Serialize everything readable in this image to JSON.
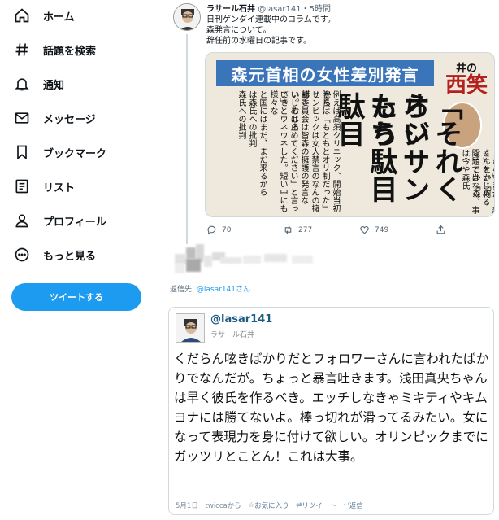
{
  "sidebar": {
    "items": [
      {
        "label": "ホーム",
        "icon": "home-icon"
      },
      {
        "label": "話題を検索",
        "icon": "hashtag-icon"
      },
      {
        "label": "通知",
        "icon": "bell-icon"
      },
      {
        "label": "メッセージ",
        "icon": "mail-icon"
      },
      {
        "label": "ブックマーク",
        "icon": "bookmark-icon"
      },
      {
        "label": "リスト",
        "icon": "list-icon"
      },
      {
        "label": "プロフィール",
        "icon": "person-icon"
      },
      {
        "label": "もっと見る",
        "icon": "more-icon"
      }
    ],
    "tweet_button": "ツイートする"
  },
  "tweet": {
    "name": "ラサール石井",
    "handle": "@lasar141",
    "separator": "・",
    "time": "5時間",
    "lines": [
      "日刊ゲンダイ連載中のコラムです。",
      "森発言について。",
      "辞任前の水曜日の記事です。"
    ],
    "media": {
      "banner": "森元首相の女性差別発言",
      "column_small": "井の",
      "column_big": "西笑",
      "headline_columns": [
        "「それくらい",
        "オジサンたち",
        "もう駄目駄目"
      ],
      "body_columns": [
        "氏への批判はうらく」とか「何",
        "すぎる」とか「森さんをいじめるな」とか「森",
        "問題ではなく、事は今や森氏",
        "例えば高須クリニック、開始当初から",
        "院長は「もともとオリ制だった」と",
        "リンピックは女人禁言のなんの擁護",
        "制委員会は皆森の擁護の発言ない。むしろ",
        "いじめは止めてください」と言ってき",
        "い」とウネウネした。短い中にも様々な",
        "と国にはまだ、まだ来るから",
        "は森氏への批判",
        "森氏への批判"
      ]
    },
    "actions": {
      "replies": "70",
      "retweets": "277",
      "likes": "749"
    }
  },
  "reply_to": {
    "prefix": "返信先: ",
    "mention": "@lasar141さん"
  },
  "embed": {
    "handle": "@lasar141",
    "name": "ラサール石井",
    "text": "くだらん呟きばかりだとフォロワーさんに言われたばかりでなんだが。ちょっと暴言吐きます。浅田真央ちゃんは早く彼氏を作るべき。エッチしなきゃミキティやキムヨナには勝てないよ。棒っ切れが滑ってるみたい。女になって表現力を身に付けて欲しい。オリンピックまでにガッツリとことん！これは大事。",
    "footer": {
      "date": "5月1日",
      "via": "twiccaから",
      "favorite": "お気に入り",
      "retweet": "リツイート",
      "reply": "返信"
    }
  },
  "colors": {
    "accent": "#1d9bf0",
    "banner": "#3a74b9",
    "text": "#0f1419",
    "muted": "#536471",
    "embed_handle": "#1b5a82"
  }
}
